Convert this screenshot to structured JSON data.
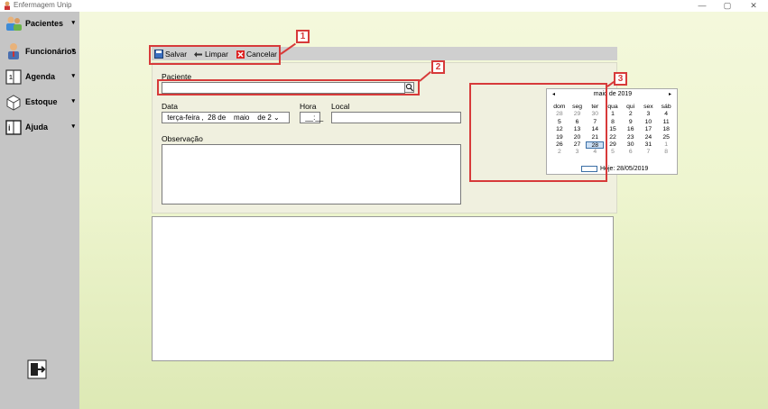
{
  "window": {
    "title": "Enfermagem Unip",
    "minimize": "—",
    "maximize": "▢",
    "close": "✕"
  },
  "sidebar": {
    "items": [
      {
        "label": "Pacientes",
        "icon": "patients-icon"
      },
      {
        "label": "Funcionários",
        "icon": "employees-icon"
      },
      {
        "label": "Agenda",
        "icon": "calendar-book-icon"
      },
      {
        "label": "Estoque",
        "icon": "box-icon"
      },
      {
        "label": "Ajuda",
        "icon": "info-book-icon"
      }
    ],
    "exit_icon": "exit-door-icon"
  },
  "toolbar": {
    "save_label": "Salvar",
    "clear_label": "Limpar",
    "cancel_label": "Cancelar"
  },
  "form": {
    "patient_label": "Paciente",
    "patient_value": "",
    "date_label": "Data",
    "date_value": " terça-feira ,  28 de    maio    de 2 ⌄",
    "hour_label": "Hora",
    "hour_value": " __:__",
    "local_label": "Local",
    "local_value": "",
    "notes_label": "Observação",
    "notes_value": ""
  },
  "calendar": {
    "month_title": "maio de 2019",
    "prev": "◂",
    "next": "▸",
    "weekdays": [
      "dom",
      "seg",
      "ter",
      "qua",
      "qui",
      "sex",
      "sáb"
    ],
    "days": [
      [
        "28",
        "29",
        "30",
        "1",
        "2",
        "3",
        "4"
      ],
      [
        "5",
        "6",
        "7",
        "8",
        "9",
        "10",
        "11"
      ],
      [
        "12",
        "13",
        "14",
        "15",
        "16",
        "17",
        "18"
      ],
      [
        "19",
        "20",
        "21",
        "22",
        "23",
        "24",
        "25"
      ],
      [
        "26",
        "27",
        "28",
        "29",
        "30",
        "31",
        "1"
      ],
      [
        "2",
        "3",
        "4",
        "5",
        "6",
        "7",
        "8"
      ]
    ],
    "selected": "28",
    "today_label": "Hoje: 28/05/2019"
  },
  "callouts": [
    "1",
    "2",
    "3"
  ],
  "colors": {
    "callout": "#d73a3a",
    "sidebar": "#c5c5c5",
    "toolbar": "#cfcfcf"
  }
}
